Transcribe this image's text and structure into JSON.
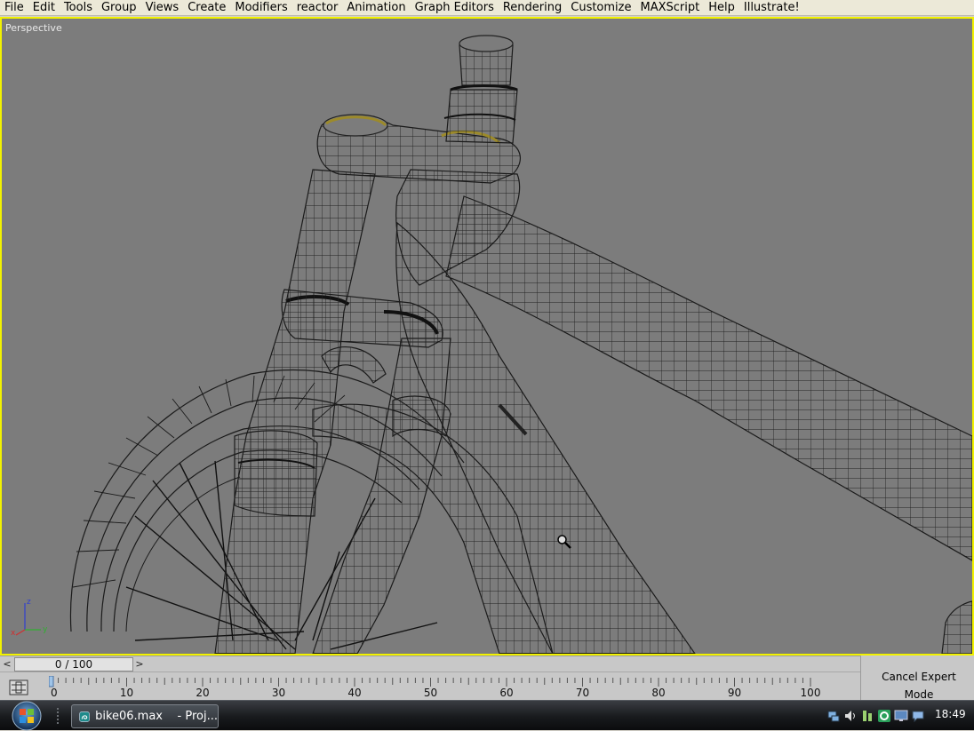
{
  "menu": {
    "items": [
      "File",
      "Edit",
      "Tools",
      "Group",
      "Views",
      "Create",
      "Modifiers",
      "reactor",
      "Animation",
      "Graph Editors",
      "Rendering",
      "Customize",
      "MAXScript",
      "Help",
      "Illustrate!"
    ]
  },
  "viewport": {
    "label": "Perspective",
    "axes": {
      "x": "x",
      "y": "y",
      "z": "z"
    }
  },
  "time_slider": {
    "frame_text": "0 / 100",
    "prev_glyph": "<",
    "next_glyph": ">"
  },
  "trackbar": {
    "ticks": [
      "0",
      "10",
      "20",
      "30",
      "40",
      "50",
      "60",
      "70",
      "80",
      "90",
      "100"
    ]
  },
  "expert_mode": {
    "cancel_label": "Cancel Expert Mode"
  },
  "taskbar": {
    "window_label": "bike06.max    - Proj...",
    "clock": "18:49"
  },
  "colors": {
    "viewport_bg": "#7c7c7c",
    "active_border": "#f2f200",
    "wire": "#1a1a1a"
  }
}
